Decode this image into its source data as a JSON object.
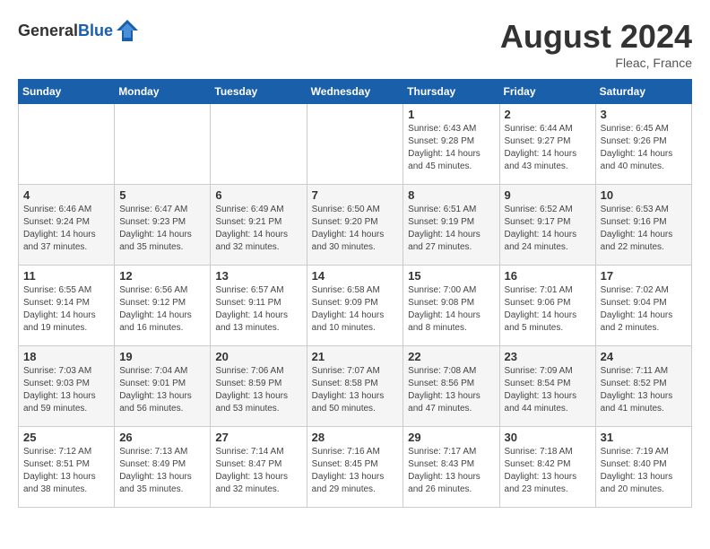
{
  "header": {
    "logo_general": "General",
    "logo_blue": "Blue",
    "month_year": "August 2024",
    "location": "Fleac, France"
  },
  "days_of_week": [
    "Sunday",
    "Monday",
    "Tuesday",
    "Wednesday",
    "Thursday",
    "Friday",
    "Saturday"
  ],
  "weeks": [
    [
      {
        "day": "",
        "info": ""
      },
      {
        "day": "",
        "info": ""
      },
      {
        "day": "",
        "info": ""
      },
      {
        "day": "",
        "info": ""
      },
      {
        "day": "1",
        "info": "Sunrise: 6:43 AM\nSunset: 9:28 PM\nDaylight: 14 hours\nand 45 minutes."
      },
      {
        "day": "2",
        "info": "Sunrise: 6:44 AM\nSunset: 9:27 PM\nDaylight: 14 hours\nand 43 minutes."
      },
      {
        "day": "3",
        "info": "Sunrise: 6:45 AM\nSunset: 9:26 PM\nDaylight: 14 hours\nand 40 minutes."
      }
    ],
    [
      {
        "day": "4",
        "info": "Sunrise: 6:46 AM\nSunset: 9:24 PM\nDaylight: 14 hours\nand 37 minutes."
      },
      {
        "day": "5",
        "info": "Sunrise: 6:47 AM\nSunset: 9:23 PM\nDaylight: 14 hours\nand 35 minutes."
      },
      {
        "day": "6",
        "info": "Sunrise: 6:49 AM\nSunset: 9:21 PM\nDaylight: 14 hours\nand 32 minutes."
      },
      {
        "day": "7",
        "info": "Sunrise: 6:50 AM\nSunset: 9:20 PM\nDaylight: 14 hours\nand 30 minutes."
      },
      {
        "day": "8",
        "info": "Sunrise: 6:51 AM\nSunset: 9:19 PM\nDaylight: 14 hours\nand 27 minutes."
      },
      {
        "day": "9",
        "info": "Sunrise: 6:52 AM\nSunset: 9:17 PM\nDaylight: 14 hours\nand 24 minutes."
      },
      {
        "day": "10",
        "info": "Sunrise: 6:53 AM\nSunset: 9:16 PM\nDaylight: 14 hours\nand 22 minutes."
      }
    ],
    [
      {
        "day": "11",
        "info": "Sunrise: 6:55 AM\nSunset: 9:14 PM\nDaylight: 14 hours\nand 19 minutes."
      },
      {
        "day": "12",
        "info": "Sunrise: 6:56 AM\nSunset: 9:12 PM\nDaylight: 14 hours\nand 16 minutes."
      },
      {
        "day": "13",
        "info": "Sunrise: 6:57 AM\nSunset: 9:11 PM\nDaylight: 14 hours\nand 13 minutes."
      },
      {
        "day": "14",
        "info": "Sunrise: 6:58 AM\nSunset: 9:09 PM\nDaylight: 14 hours\nand 10 minutes."
      },
      {
        "day": "15",
        "info": "Sunrise: 7:00 AM\nSunset: 9:08 PM\nDaylight: 14 hours\nand 8 minutes."
      },
      {
        "day": "16",
        "info": "Sunrise: 7:01 AM\nSunset: 9:06 PM\nDaylight: 14 hours\nand 5 minutes."
      },
      {
        "day": "17",
        "info": "Sunrise: 7:02 AM\nSunset: 9:04 PM\nDaylight: 14 hours\nand 2 minutes."
      }
    ],
    [
      {
        "day": "18",
        "info": "Sunrise: 7:03 AM\nSunset: 9:03 PM\nDaylight: 13 hours\nand 59 minutes."
      },
      {
        "day": "19",
        "info": "Sunrise: 7:04 AM\nSunset: 9:01 PM\nDaylight: 13 hours\nand 56 minutes."
      },
      {
        "day": "20",
        "info": "Sunrise: 7:06 AM\nSunset: 8:59 PM\nDaylight: 13 hours\nand 53 minutes."
      },
      {
        "day": "21",
        "info": "Sunrise: 7:07 AM\nSunset: 8:58 PM\nDaylight: 13 hours\nand 50 minutes."
      },
      {
        "day": "22",
        "info": "Sunrise: 7:08 AM\nSunset: 8:56 PM\nDaylight: 13 hours\nand 47 minutes."
      },
      {
        "day": "23",
        "info": "Sunrise: 7:09 AM\nSunset: 8:54 PM\nDaylight: 13 hours\nand 44 minutes."
      },
      {
        "day": "24",
        "info": "Sunrise: 7:11 AM\nSunset: 8:52 PM\nDaylight: 13 hours\nand 41 minutes."
      }
    ],
    [
      {
        "day": "25",
        "info": "Sunrise: 7:12 AM\nSunset: 8:51 PM\nDaylight: 13 hours\nand 38 minutes."
      },
      {
        "day": "26",
        "info": "Sunrise: 7:13 AM\nSunset: 8:49 PM\nDaylight: 13 hours\nand 35 minutes."
      },
      {
        "day": "27",
        "info": "Sunrise: 7:14 AM\nSunset: 8:47 PM\nDaylight: 13 hours\nand 32 minutes."
      },
      {
        "day": "28",
        "info": "Sunrise: 7:16 AM\nSunset: 8:45 PM\nDaylight: 13 hours\nand 29 minutes."
      },
      {
        "day": "29",
        "info": "Sunrise: 7:17 AM\nSunset: 8:43 PM\nDaylight: 13 hours\nand 26 minutes."
      },
      {
        "day": "30",
        "info": "Sunrise: 7:18 AM\nSunset: 8:42 PM\nDaylight: 13 hours\nand 23 minutes."
      },
      {
        "day": "31",
        "info": "Sunrise: 7:19 AM\nSunset: 8:40 PM\nDaylight: 13 hours\nand 20 minutes."
      }
    ]
  ]
}
